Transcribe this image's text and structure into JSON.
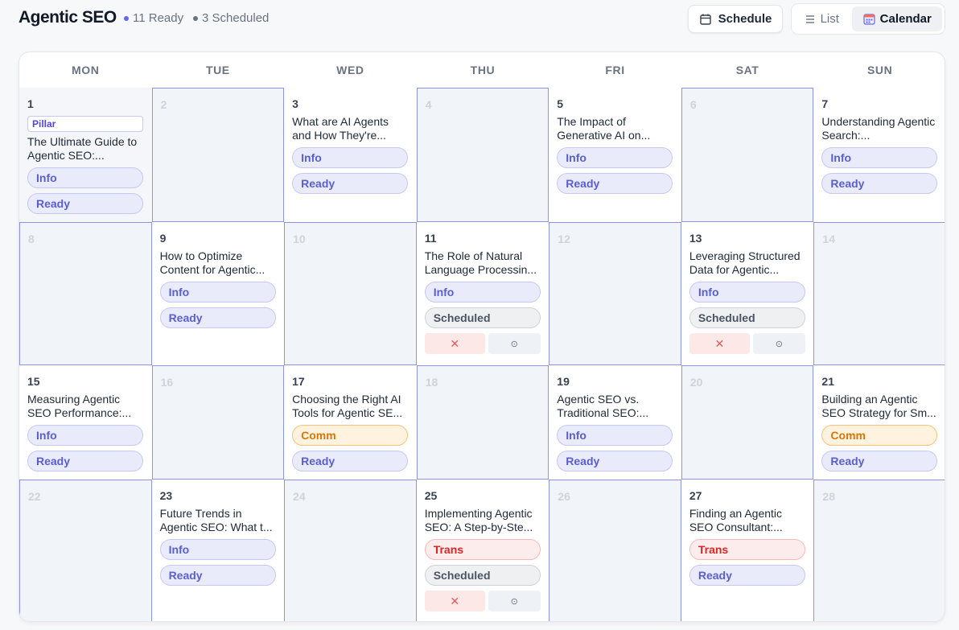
{
  "header": {
    "title": "Agentic SEO",
    "ready_count": "11 Ready",
    "scheduled_count": "3 Scheduled",
    "schedule_button": "Schedule",
    "list_label": "List",
    "calendar_label": "Calendar"
  },
  "days_of_week": [
    "MON",
    "TUE",
    "WED",
    "THU",
    "FRI",
    "SAT",
    "SUN"
  ],
  "colors": {
    "accent": "#5a5fd0",
    "empty_border": "#8b93e8",
    "comm": "#d97706",
    "trans": "#dc2626"
  },
  "cells": [
    {
      "day": "1",
      "pillar": "Pillar",
      "title": "The Ultimate Guide to Agentic SEO:...",
      "chips": [
        {
          "type": "info",
          "label": "Info"
        },
        {
          "type": "ready",
          "label": "Ready"
        }
      ]
    },
    {
      "day": "2",
      "empty": true
    },
    {
      "day": "3",
      "title": "What are AI Agents and How They're...",
      "chips": [
        {
          "type": "info",
          "label": "Info"
        },
        {
          "type": "ready",
          "label": "Ready"
        }
      ]
    },
    {
      "day": "4",
      "empty": true
    },
    {
      "day": "5",
      "title": "The Impact of Generative AI on...",
      "chips": [
        {
          "type": "info",
          "label": "Info"
        },
        {
          "type": "ready",
          "label": "Ready"
        }
      ]
    },
    {
      "day": "6",
      "empty": true
    },
    {
      "day": "7",
      "title": "Understanding Agentic Search:...",
      "chips": [
        {
          "type": "info",
          "label": "Info"
        },
        {
          "type": "ready",
          "label": "Ready"
        }
      ]
    },
    {
      "day": "8",
      "empty": true
    },
    {
      "day": "9",
      "title": "How to Optimize Content for Agentic...",
      "chips": [
        {
          "type": "info",
          "label": "Info"
        },
        {
          "type": "ready",
          "label": "Ready"
        }
      ]
    },
    {
      "day": "10",
      "empty": true
    },
    {
      "day": "11",
      "title": "The Role of Natural Language Processin...",
      "chips": [
        {
          "type": "info",
          "label": "Info"
        },
        {
          "type": "sched",
          "label": "Scheduled"
        }
      ],
      "actions": true
    },
    {
      "day": "12",
      "empty": true
    },
    {
      "day": "13",
      "title": "Leveraging Structured Data for Agentic...",
      "chips": [
        {
          "type": "info",
          "label": "Info"
        },
        {
          "type": "sched",
          "label": "Scheduled"
        }
      ],
      "actions": true
    },
    {
      "day": "14",
      "empty": true
    },
    {
      "day": "15",
      "title": "Measuring Agentic SEO Performance:...",
      "chips": [
        {
          "type": "info",
          "label": "Info"
        },
        {
          "type": "ready",
          "label": "Ready"
        }
      ]
    },
    {
      "day": "16",
      "empty": true
    },
    {
      "day": "17",
      "title": "Choosing the Right AI Tools for Agentic SE...",
      "chips": [
        {
          "type": "comm",
          "label": "Comm"
        },
        {
          "type": "ready",
          "label": "Ready"
        }
      ]
    },
    {
      "day": "18",
      "empty": true
    },
    {
      "day": "19",
      "title": "Agentic SEO vs. Traditional SEO:...",
      "chips": [
        {
          "type": "info",
          "label": "Info"
        },
        {
          "type": "ready",
          "label": "Ready"
        }
      ]
    },
    {
      "day": "20",
      "empty": true
    },
    {
      "day": "21",
      "title": "Building an Agentic SEO Strategy for Sm...",
      "chips": [
        {
          "type": "comm",
          "label": "Comm"
        },
        {
          "type": "ready",
          "label": "Ready"
        }
      ]
    },
    {
      "day": "22",
      "empty": true
    },
    {
      "day": "23",
      "title": "Future Trends in Agentic SEO: What t...",
      "chips": [
        {
          "type": "info",
          "label": "Info"
        },
        {
          "type": "ready",
          "label": "Ready"
        }
      ]
    },
    {
      "day": "24",
      "empty": true
    },
    {
      "day": "25",
      "title": "Implementing Agentic SEO: A Step-by-Ste...",
      "chips": [
        {
          "type": "trans",
          "label": "Trans"
        },
        {
          "type": "sched",
          "label": "Scheduled"
        }
      ],
      "actions": true
    },
    {
      "day": "26",
      "empty": true
    },
    {
      "day": "27",
      "title": "Finding an Agentic SEO Consultant:...",
      "chips": [
        {
          "type": "trans",
          "label": "Trans"
        },
        {
          "type": "ready",
          "label": "Ready"
        }
      ]
    },
    {
      "day": "28",
      "empty": true
    }
  ],
  "action_icons": {
    "remove": "close-icon",
    "more": "settings-icon"
  }
}
